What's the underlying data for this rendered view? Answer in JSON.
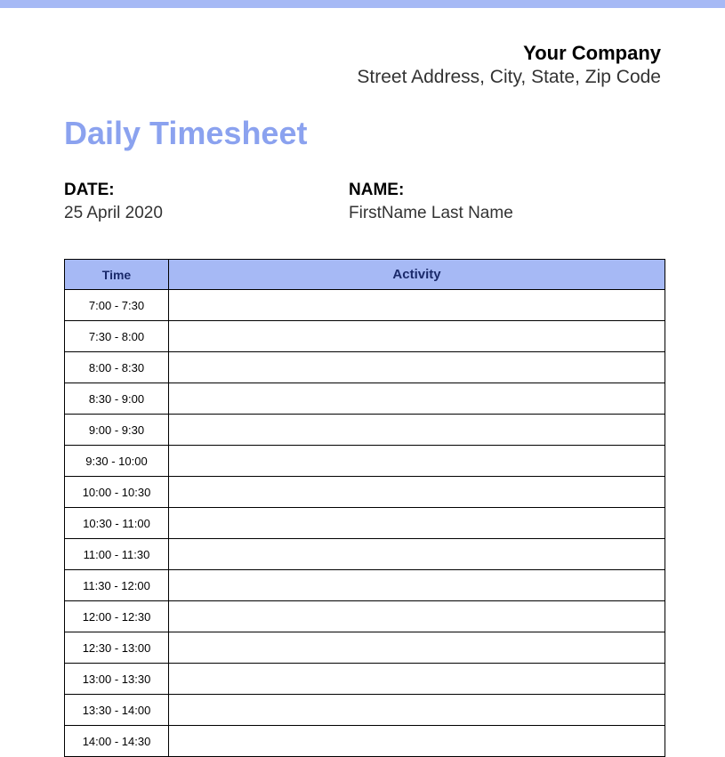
{
  "header": {
    "company_name": "Your Company",
    "company_address": "Street Address, City, State, Zip Code"
  },
  "title": "Daily Timesheet",
  "meta": {
    "date_label": "DATE:",
    "date_value": "25 April 2020",
    "name_label": "NAME:",
    "name_value": "FirstName Last Name"
  },
  "table": {
    "col_time": "Time",
    "col_activity": "Activity",
    "rows": [
      {
        "time": "7:00 - 7:30",
        "activity": ""
      },
      {
        "time": "7:30 - 8:00",
        "activity": ""
      },
      {
        "time": "8:00 - 8:30",
        "activity": ""
      },
      {
        "time": "8:30 - 9:00",
        "activity": ""
      },
      {
        "time": "9:00 - 9:30",
        "activity": ""
      },
      {
        "time": "9:30 - 10:00",
        "activity": ""
      },
      {
        "time": "10:00 - 10:30",
        "activity": ""
      },
      {
        "time": "10:30 - 11:00",
        "activity": ""
      },
      {
        "time": "11:00 - 11:30",
        "activity": ""
      },
      {
        "time": "11:30 - 12:00",
        "activity": ""
      },
      {
        "time": "12:00 - 12:30",
        "activity": ""
      },
      {
        "time": "12:30 - 13:00",
        "activity": ""
      },
      {
        "time": "13:00 - 13:30",
        "activity": ""
      },
      {
        "time": "13:30 - 14:00",
        "activity": ""
      },
      {
        "time": "14:00 - 14:30",
        "activity": ""
      }
    ]
  }
}
